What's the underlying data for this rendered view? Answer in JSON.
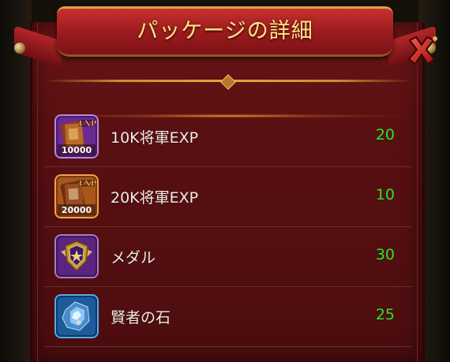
{
  "dialog": {
    "title": "パッケージの詳細"
  },
  "items": [
    {
      "name": "10K将軍EXP",
      "quantity": "20",
      "icon": "exp-book-purple-icon",
      "badge": "10000",
      "badge_tag": "EXP"
    },
    {
      "name": "20K将軍EXP",
      "quantity": "10",
      "icon": "exp-book-orange-icon",
      "badge": "20000",
      "badge_tag": "EXP"
    },
    {
      "name": "メダル",
      "quantity": "30",
      "icon": "medal-icon"
    },
    {
      "name": "賢者の石",
      "quantity": "25",
      "icon": "sage-stone-icon"
    }
  ],
  "colors": {
    "title": "#ffe48a",
    "quantity": "#3ddc2f",
    "panel": "#5a1012",
    "banner": "#a01e20"
  }
}
